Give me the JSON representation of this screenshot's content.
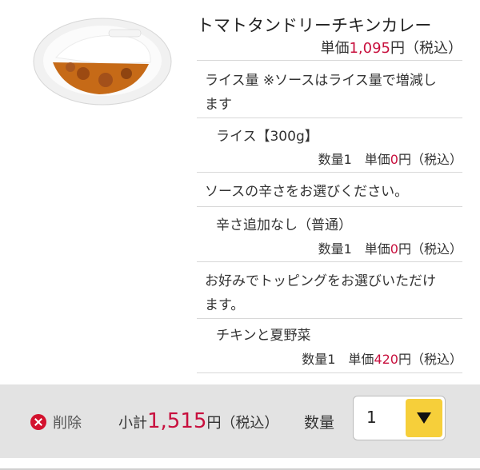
{
  "product": {
    "image_name": "curry-plate-image",
    "title": "トマトタンドリーチキンカレー",
    "unit_price_label": "単価",
    "unit_price": "1,095",
    "unit_price_suffix": "円（税込）"
  },
  "options": [
    {
      "heading_line1": "ライス量 ※ソースはライス量で増減し",
      "heading_line2": "ます",
      "choice": "ライス【300g】",
      "qty_prefix": "数量1　単価",
      "price": "0",
      "price_suffix": "円（税込）"
    },
    {
      "heading_line1": "ソースの辛さをお選びください。",
      "choice": "辛さ追加なし（普通）",
      "qty_prefix": "数量1　単価",
      "price": "0",
      "price_suffix": "円（税込）"
    },
    {
      "heading_line1": "お好みでトッピングをお選びいただけ",
      "heading_line2": "ます。",
      "choice": "チキンと夏野菜",
      "qty_prefix": "数量1　単価",
      "price": "420",
      "price_suffix": "円（税込）"
    }
  ],
  "footer": {
    "delete_label": "削除",
    "subtotal_label": "小計",
    "subtotal_amount": "1,515",
    "subtotal_suffix": "円（税込）",
    "quantity_label": "数量",
    "quantity_value": "1"
  },
  "colors": {
    "price_red": "#c8103e",
    "dropdown_yellow": "#f6cf3a",
    "footer_bg": "#e3e3e3"
  }
}
